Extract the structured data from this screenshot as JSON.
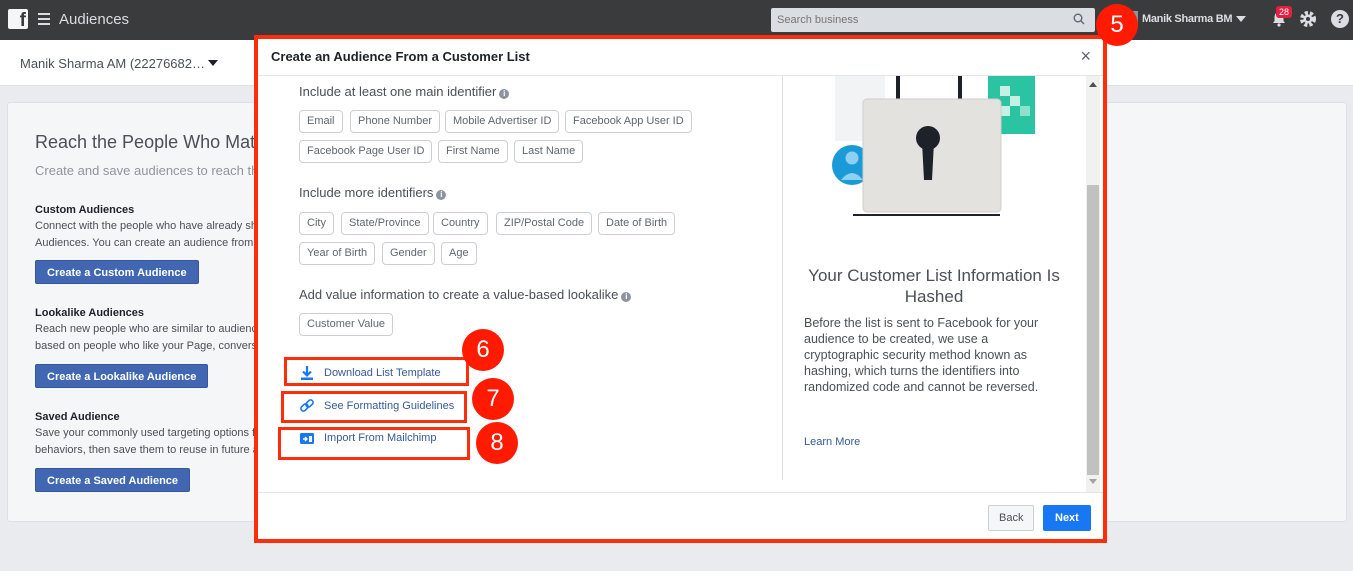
{
  "topbar": {
    "logo_letter": "f",
    "app_title": "Audiences",
    "search_placeholder": "Search business",
    "user_name": "Manik Sharma BM",
    "notification_count": "28"
  },
  "account": {
    "name": "Manik Sharma AM (22276682…"
  },
  "background": {
    "heading": "Reach the People Who Mat",
    "subheading": "Create and save audiences to reach th",
    "sections": [
      {
        "title": "Custom Audiences",
        "lines": [
          "Connect with the people who have already sh",
          "Audiences. You can create an audience from "
        ],
        "button": "Create a Custom Audience"
      },
      {
        "title": "Lookalike Audiences",
        "lines": [
          "Reach new people who are similar to audienc",
          "based on people who like your Page, convers"
        ],
        "button": "Create a Lookalike Audience"
      },
      {
        "title": "Saved Audience",
        "lines": [
          "Save your commonly used targeting options fo",
          "behaviors, then save them to reuse in future a"
        ],
        "button": "Create a Saved Audience"
      }
    ]
  },
  "modal": {
    "title": "Create an Audience From a Customer List",
    "close_symbol": "×",
    "main_identifier_label": "Include at least one main identifier",
    "main_identifiers": [
      "Email",
      "Phone Number",
      "Mobile Advertiser ID",
      "Facebook App User ID",
      "Facebook Page User ID",
      "First Name",
      "Last Name"
    ],
    "more_identifiers_label": "Include more identifiers",
    "more_identifiers": [
      "City",
      "State/Province",
      "Country",
      "ZIP/Postal Code",
      "Date of Birth",
      "Year of Birth",
      "Gender",
      "Age"
    ],
    "value_label": "Add value information to create a value-based lookalike",
    "value_identifiers": [
      "Customer Value"
    ],
    "links": {
      "download": "Download List Template",
      "formatting": "See Formatting Guidelines",
      "mailchimp": "Import From Mailchimp"
    },
    "info": {
      "title": "Your Customer List Information Is Hashed",
      "text": "Before the list is sent to Facebook for your audience to be created, we use a cryptographic security method known as hashing, which turns the identifiers into randomized code and cannot be reversed.",
      "learn_more": "Learn More"
    },
    "back_label": "Back",
    "next_label": "Next"
  },
  "callouts": {
    "c5": "5",
    "c6": "6",
    "c7": "7",
    "c8": "8"
  },
  "colors": {
    "accent": "#1877f2",
    "callout": "#ff1a00",
    "topbar": "#3a3b3c"
  }
}
